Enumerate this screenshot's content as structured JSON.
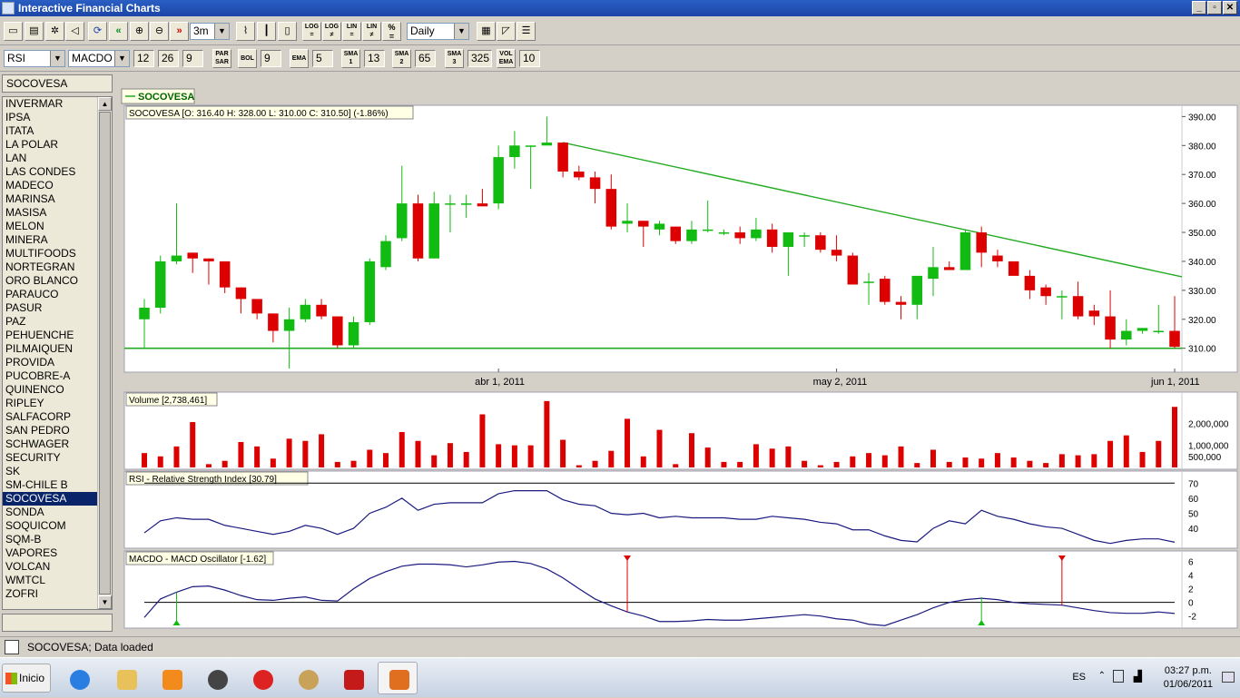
{
  "window": {
    "title": "Interactive Financial Charts"
  },
  "toolbar1": {
    "period": "3m",
    "interval": "Daily",
    "zoom_in_symbol": "»",
    "zoom_out_symbol": "«",
    "log1": "LOG",
    "log2": "LOG",
    "lin1": "LIN",
    "lin2": "LIN",
    "pct": "%"
  },
  "toolbar2": {
    "ind1": "RSI",
    "ind2": "MACDO",
    "macd_fast": "12",
    "macd_slow": "26",
    "macd_signal": "9",
    "parsar": "PAR SAR",
    "bol": "BOL",
    "bol_val": "9",
    "ema": "EMA",
    "ema_val": "5",
    "sma1": "SMA 1",
    "sma1_val": "13",
    "sma2": "SMA 2",
    "sma2_val": "65",
    "sma3": "SMA 3",
    "sma3_val": "325",
    "volema": "VOL EMA",
    "volema_val": "10"
  },
  "symbol": {
    "current": "SOCOVESA"
  },
  "list": [
    "INVERMAR",
    "IPSA",
    "ITATA",
    "LA POLAR",
    "LAN",
    "LAS CONDES",
    "MADECO",
    "MARINSA",
    "MASISA",
    "MELON",
    "MINERA",
    "MULTIFOODS",
    "NORTEGRAN",
    "ORO BLANCO",
    "PARAUCO",
    "PASUR",
    "PAZ",
    "PEHUENCHE",
    "PILMAIQUEN",
    "PROVIDA",
    "PUCOBRE-A",
    "QUINENCO",
    "RIPLEY",
    "SALFACORP",
    "SAN PEDRO",
    "SCHWAGER",
    "SECURITY",
    "SK",
    "SM-CHILE B",
    "SOCOVESA",
    "SONDA",
    "SOQUICOM",
    "SQM-B",
    "VAPORES",
    "VOLCAN",
    "WMTCL",
    "ZOFRI"
  ],
  "selected": "SOCOVESA",
  "chart": {
    "legend": "SOCOVESA",
    "price_label": "SOCOVESA [O: 316.40  H: 328.00  L: 310.00  C: 310.50] (-1.86%)",
    "volume_label": "Volume [2,738,461]",
    "rsi_label": "RSI - Relative Strength Index [30.79]",
    "macd_label": "MACDO - MACD Oscillator [-1.62]",
    "x_ticks": [
      "abr 1, 2011",
      "may 2, 2011",
      "jun 1, 2011"
    ],
    "price_ticks": [
      "390.00",
      "380.00",
      "370.00",
      "360.00",
      "350.00",
      "340.00",
      "330.00",
      "320.00",
      "310.00"
    ],
    "volume_ticks": [
      "2,000,000",
      "1,000,000",
      "500,000"
    ],
    "rsi_ticks": [
      "70",
      "60",
      "50",
      "40"
    ],
    "macd_ticks": [
      "6",
      "4",
      "2",
      "0",
      "-2"
    ]
  },
  "chart_data": {
    "type": "candlestick",
    "symbol": "SOCOVESA",
    "price_range": [
      303,
      392
    ],
    "colors": {
      "up": "#11bb11",
      "down": "#dd0000",
      "trend": "#22aa22",
      "ind": "#1a1a80"
    },
    "ohlc": [
      [
        320,
        327,
        310,
        324
      ],
      [
        324,
        342,
        322,
        340
      ],
      [
        340,
        360,
        339,
        342
      ],
      [
        343,
        343,
        336,
        341
      ],
      [
        341,
        341,
        332,
        340
      ],
      [
        340,
        340,
        329,
        331
      ],
      [
        331,
        331,
        322,
        327
      ],
      [
        327,
        327,
        320,
        322
      ],
      [
        322,
        322,
        312,
        316
      ],
      [
        316,
        324,
        303,
        320
      ],
      [
        320,
        327,
        319,
        325
      ],
      [
        325,
        327,
        320,
        321
      ],
      [
        321,
        321,
        310,
        311
      ],
      [
        311,
        321,
        310,
        319
      ],
      [
        319,
        341,
        318,
        340
      ],
      [
        338,
        349,
        337,
        347
      ],
      [
        348,
        373,
        347,
        360
      ],
      [
        360,
        363,
        340,
        341
      ],
      [
        341,
        364,
        341,
        360
      ],
      [
        360,
        363,
        350,
        360
      ],
      [
        360,
        363,
        355,
        360
      ],
      [
        360,
        365,
        359,
        359
      ],
      [
        360,
        380,
        358,
        376
      ],
      [
        376,
        385,
        372,
        380
      ],
      [
        380,
        380,
        365,
        380
      ],
      [
        380,
        390,
        380,
        381
      ],
      [
        381,
        381,
        369,
        371
      ],
      [
        371,
        373,
        368,
        369
      ],
      [
        369,
        371,
        360,
        365
      ],
      [
        365,
        370,
        351,
        352
      ],
      [
        353,
        360,
        350,
        354
      ],
      [
        354,
        354,
        345,
        352
      ],
      [
        351,
        354,
        349,
        353
      ],
      [
        352,
        352,
        346,
        347
      ],
      [
        347,
        354,
        346,
        351
      ],
      [
        351,
        361,
        350,
        351
      ],
      [
        350,
        351,
        349,
        350
      ],
      [
        350,
        352,
        346,
        348
      ],
      [
        348,
        355,
        347,
        351
      ],
      [
        351,
        353,
        343,
        345
      ],
      [
        345,
        350,
        335,
        350
      ],
      [
        349,
        350,
        345,
        349
      ],
      [
        349,
        350,
        343,
        344
      ],
      [
        344,
        349,
        340,
        342
      ],
      [
        342,
        343,
        332,
        332
      ],
      [
        333,
        336,
        325,
        333
      ],
      [
        334,
        335,
        325,
        326
      ],
      [
        326,
        328,
        320,
        325
      ],
      [
        325,
        335,
        320,
        335
      ],
      [
        334,
        345,
        328,
        338
      ],
      [
        338,
        340,
        337,
        337
      ],
      [
        337,
        351,
        337,
        350
      ],
      [
        350,
        352,
        338,
        343
      ],
      [
        342,
        344,
        338,
        340
      ],
      [
        340,
        340,
        336,
        335
      ],
      [
        335,
        337,
        327,
        330
      ],
      [
        331,
        332,
        325,
        328
      ],
      [
        328,
        330,
        320,
        328
      ],
      [
        328,
        333,
        320,
        321
      ],
      [
        323,
        325,
        318,
        321
      ],
      [
        321,
        330,
        310,
        313
      ],
      [
        313,
        320,
        311,
        316
      ],
      [
        316,
        317,
        315,
        317
      ],
      [
        316,
        325,
        315,
        316
      ],
      [
        316,
        328,
        310,
        310.5
      ]
    ],
    "volume": [
      650000,
      500000,
      950000,
      2050000,
      150000,
      300000,
      1150000,
      950000,
      400000,
      1300000,
      1200000,
      1500000,
      250000,
      300000,
      800000,
      650000,
      1600000,
      1200000,
      550000,
      1100000,
      700000,
      2400000,
      1050000,
      1000000,
      1000000,
      3000000,
      1250000,
      100000,
      300000,
      750000,
      2200000,
      500000,
      1700000,
      150000,
      1550000,
      900000,
      250000,
      250000,
      1050000,
      850000,
      950000,
      300000,
      100000,
      250000,
      500000,
      650000,
      550000,
      950000,
      200000,
      800000,
      250000,
      450000,
      400000,
      650000,
      450000,
      300000,
      200000,
      600000,
      550000,
      600000,
      1200000,
      1450000,
      700000,
      1200000,
      2738461
    ],
    "volume_range": [
      0,
      3200000
    ],
    "rsi": [
      37,
      45,
      47,
      46,
      46,
      42,
      40,
      38,
      36,
      38,
      42,
      40,
      36,
      40,
      50,
      54,
      60,
      52,
      56,
      57,
      57,
      57,
      63,
      65,
      65,
      65,
      59,
      56,
      55,
      50,
      49,
      50,
      47,
      48,
      47,
      47,
      47,
      46,
      46,
      48,
      47,
      46,
      44,
      43,
      39,
      39,
      35,
      32,
      31,
      40,
      45,
      43,
      52,
      48,
      46,
      43,
      41,
      40,
      36,
      32,
      30,
      32,
      33,
      33,
      30.79
    ],
    "rsi_range": [
      28,
      75
    ],
    "rsi_line": 70,
    "macd": [
      -2.2,
      0.5,
      1.5,
      2.3,
      2.4,
      1.8,
      1.0,
      0.4,
      0.3,
      0.6,
      0.8,
      0.3,
      0.2,
      2.0,
      3.5,
      4.5,
      5.3,
      5.6,
      5.6,
      5.5,
      5.2,
      5.5,
      5.9,
      6.0,
      5.7,
      4.9,
      3.6,
      2.0,
      0.5,
      -0.5,
      -1.4,
      -2.0,
      -2.8,
      -2.8,
      -2.7,
      -2.5,
      -2.6,
      -2.6,
      -2.4,
      -2.2,
      -2.0,
      -1.8,
      -2.0,
      -2.4,
      -2.6,
      -3.2,
      -3.4,
      -2.6,
      -1.8,
      -0.8,
      0.0,
      0.4,
      0.6,
      0.4,
      0.0,
      -0.2,
      -0.3,
      -0.4,
      -0.8,
      -1.2,
      -1.5,
      -1.6,
      -1.6,
      -1.4,
      -1.62
    ],
    "macd_range": [
      -3.5,
      7
    ],
    "signals": [
      {
        "i": 2,
        "type": "buy"
      },
      {
        "i": 30,
        "type": "sell"
      },
      {
        "i": 52,
        "type": "buy"
      },
      {
        "i": 57,
        "type": "sell"
      }
    ],
    "trend_line": {
      "from": [
        26,
        381
      ],
      "to": [
        65,
        334
      ]
    },
    "support_level": 310
  },
  "status": {
    "text": "SOCOVESA; Data loaded"
  },
  "taskbar": {
    "start": "Inicio",
    "lang": "ES",
    "time": "03:27 p.m.",
    "date": "01/06/2011"
  }
}
